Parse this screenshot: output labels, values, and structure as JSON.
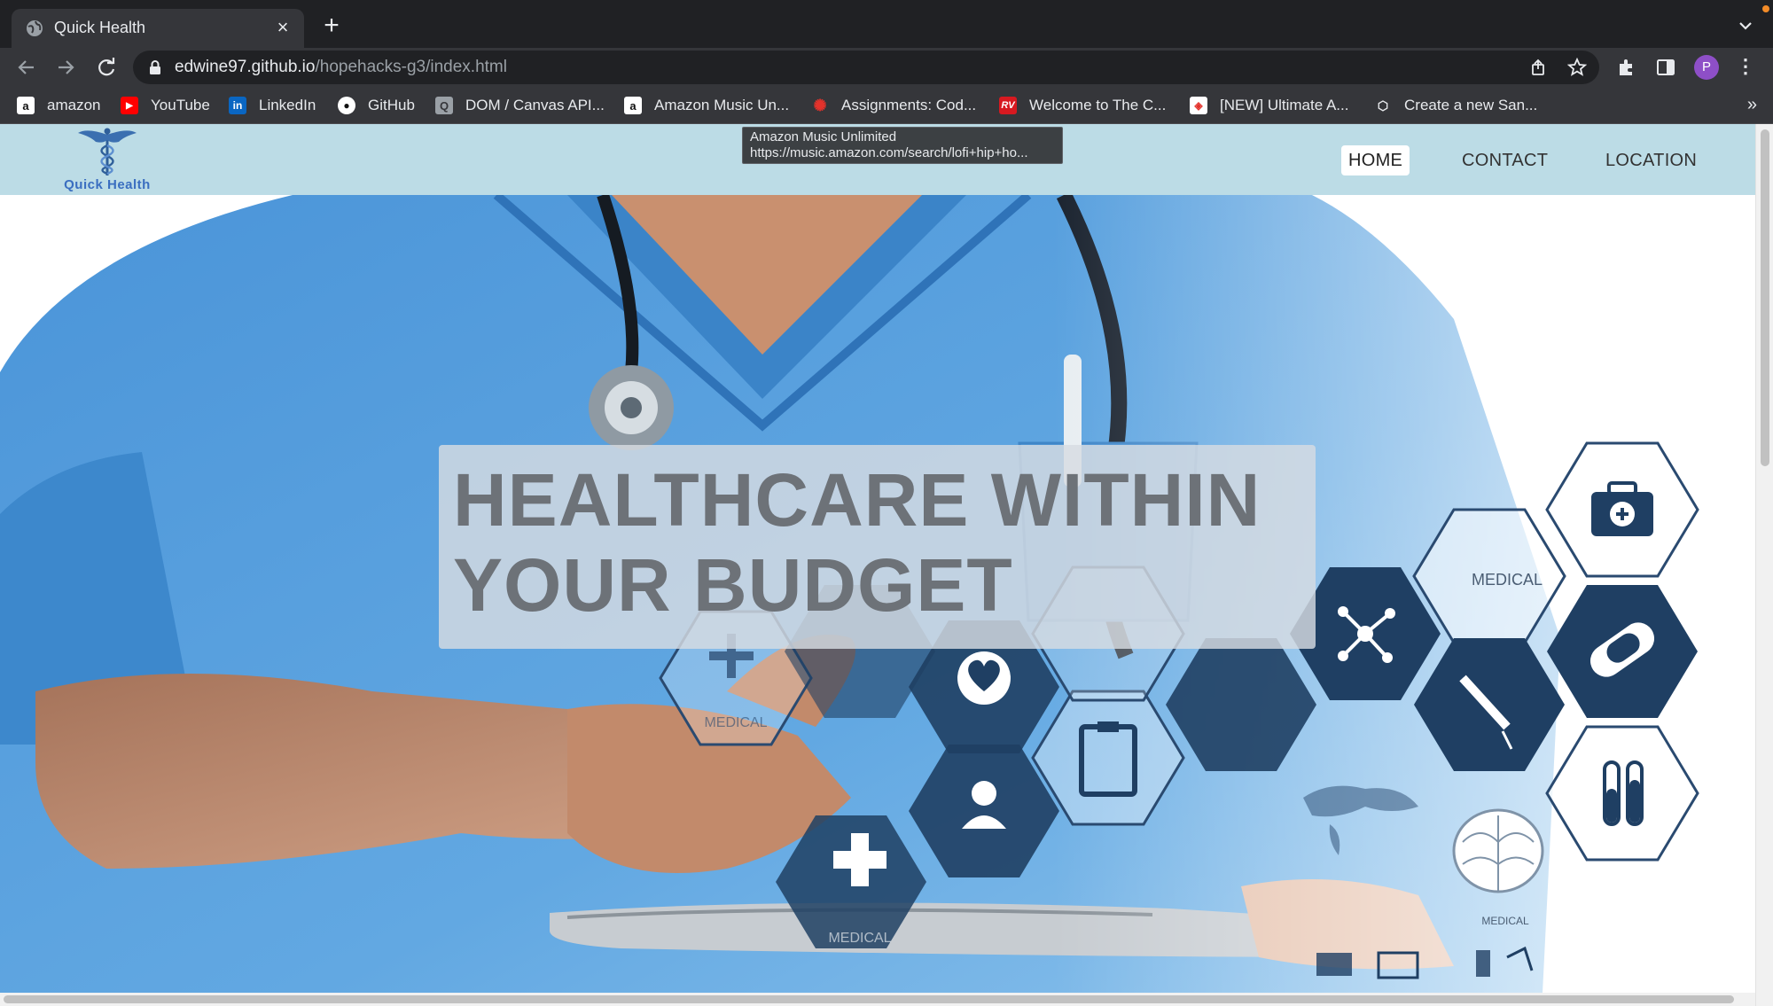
{
  "browser": {
    "tab_title": "Quick Health",
    "url_host": "edwine97.github.io",
    "url_path": "/hopehacks-g3/index.html",
    "profile_initial": "P",
    "bookmarks": [
      {
        "label": "amazon",
        "icon": "amazon-icon",
        "color": "#ffffff"
      },
      {
        "label": "YouTube",
        "icon": "youtube-icon",
        "color": "#ff0000"
      },
      {
        "label": "LinkedIn",
        "icon": "linkedin-icon",
        "color": "#0a66c2"
      },
      {
        "label": "GitHub",
        "icon": "github-icon",
        "color": "#ffffff"
      },
      {
        "label": "DOM / Canvas API...",
        "icon": "search-doc-icon",
        "color": "#cccccc"
      },
      {
        "label": "Amazon Music Un...",
        "icon": "amazon-icon",
        "color": "#ffffff"
      },
      {
        "label": "Assignments: Cod...",
        "icon": "canvas-icon",
        "color": "#e4322b"
      },
      {
        "label": "Welcome to The C...",
        "icon": "rv-icon",
        "color": "#d71920"
      },
      {
        "label": "[NEW] Ultimate A...",
        "icon": "course-icon",
        "color": "#e4322b"
      },
      {
        "label": "Create a new San...",
        "icon": "codesandbox-icon",
        "color": "#cccccc"
      }
    ]
  },
  "tooltip": {
    "title": "Amazon Music Unlimited",
    "url": "https://music.amazon.com/search/lofi+hip+ho..."
  },
  "site": {
    "logo_text": "Quick Health",
    "nav": [
      {
        "label": "HOME",
        "active": true
      },
      {
        "label": "CONTACT",
        "active": false
      },
      {
        "label": "LOCATION",
        "active": false
      }
    ],
    "headline": "HEALTHCARE WITHIN YOUR BUDGET",
    "hex_labels": {
      "medical_top": "MEDICAL",
      "medical_cross": "MEDICAL",
      "medical_bottom": "MEDICAL",
      "medical_brain": "MEDICAL"
    }
  },
  "colors": {
    "nav_bg": "#bcdce6",
    "scrub_blue": "#5aa0dc",
    "hex_navy": "#1f3f63"
  }
}
